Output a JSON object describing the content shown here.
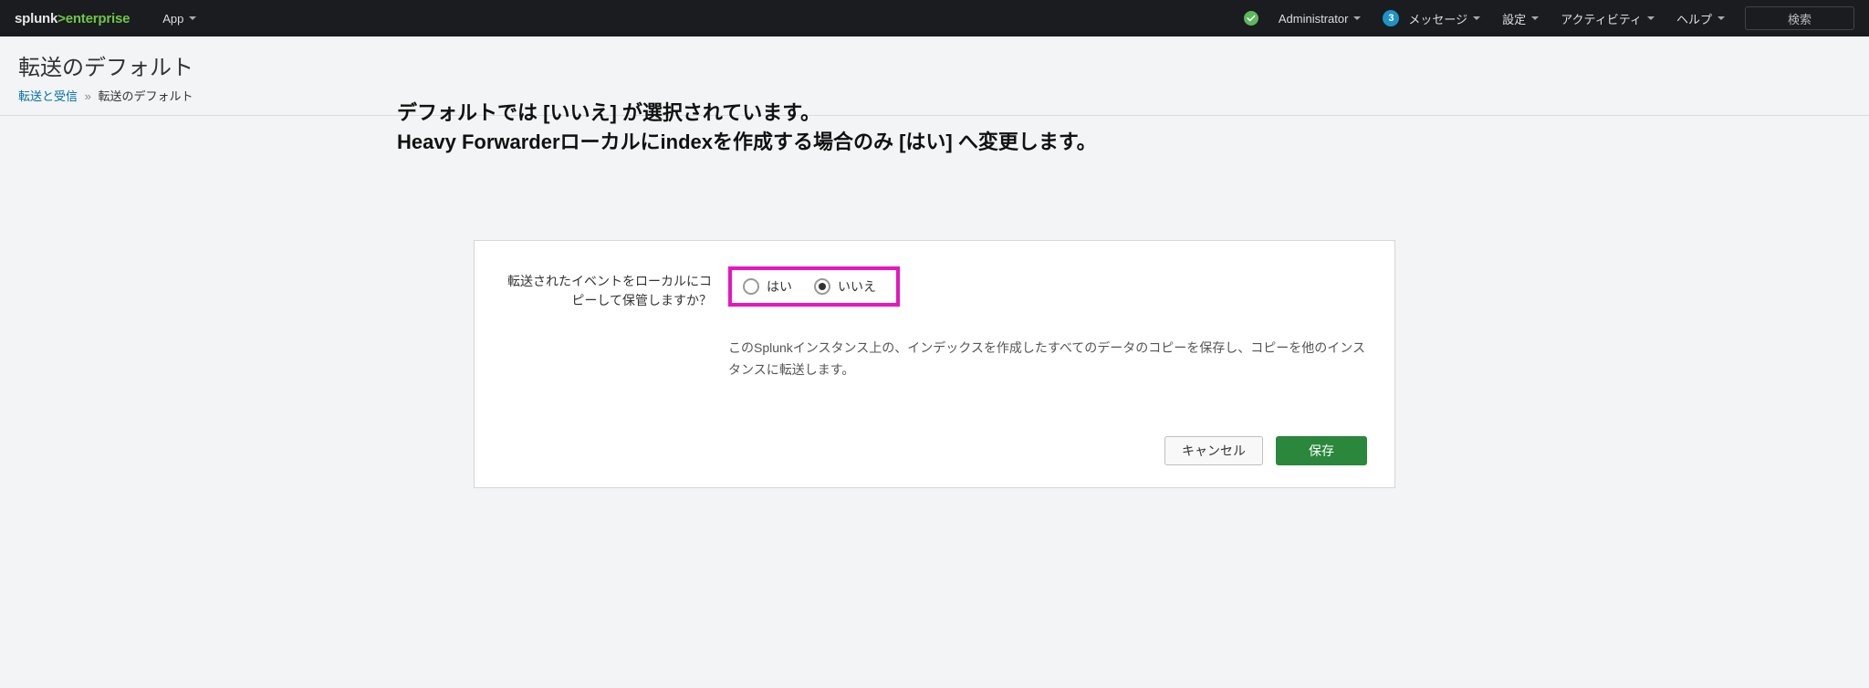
{
  "brand": {
    "prefix": "splunk",
    "gt": ">",
    "suffix": "enterprise"
  },
  "nav_left": {
    "app": "App"
  },
  "nav_right": {
    "administrator": "Administrator",
    "messages_badge": "3",
    "messages": "メッセージ",
    "settings": "設定",
    "activity": "アクティビティ",
    "help": "ヘルプ",
    "find": "検索"
  },
  "page": {
    "title": "転送のデフォルト",
    "breadcrumb_link": "転送と受信",
    "breadcrumb_sep": "»",
    "breadcrumb_current": "転送のデフォルト"
  },
  "annotation": {
    "line1": "デフォルトでは [いいえ] が選択されています。",
    "line2": "Heavy Forwarderローカルにindexを作成する場合のみ [はい] へ変更します。"
  },
  "form": {
    "label": "転送されたイベントをローカルにコピーして保管しますか？",
    "yes": "はい",
    "no": "いいえ",
    "selected": "no",
    "help": "このSplunkインスタンス上の、インデックスを作成したすべてのデータのコピーを保存し、コピーを他のインスタンスに転送します。"
  },
  "buttons": {
    "cancel": "キャンセル",
    "save": "保存"
  }
}
